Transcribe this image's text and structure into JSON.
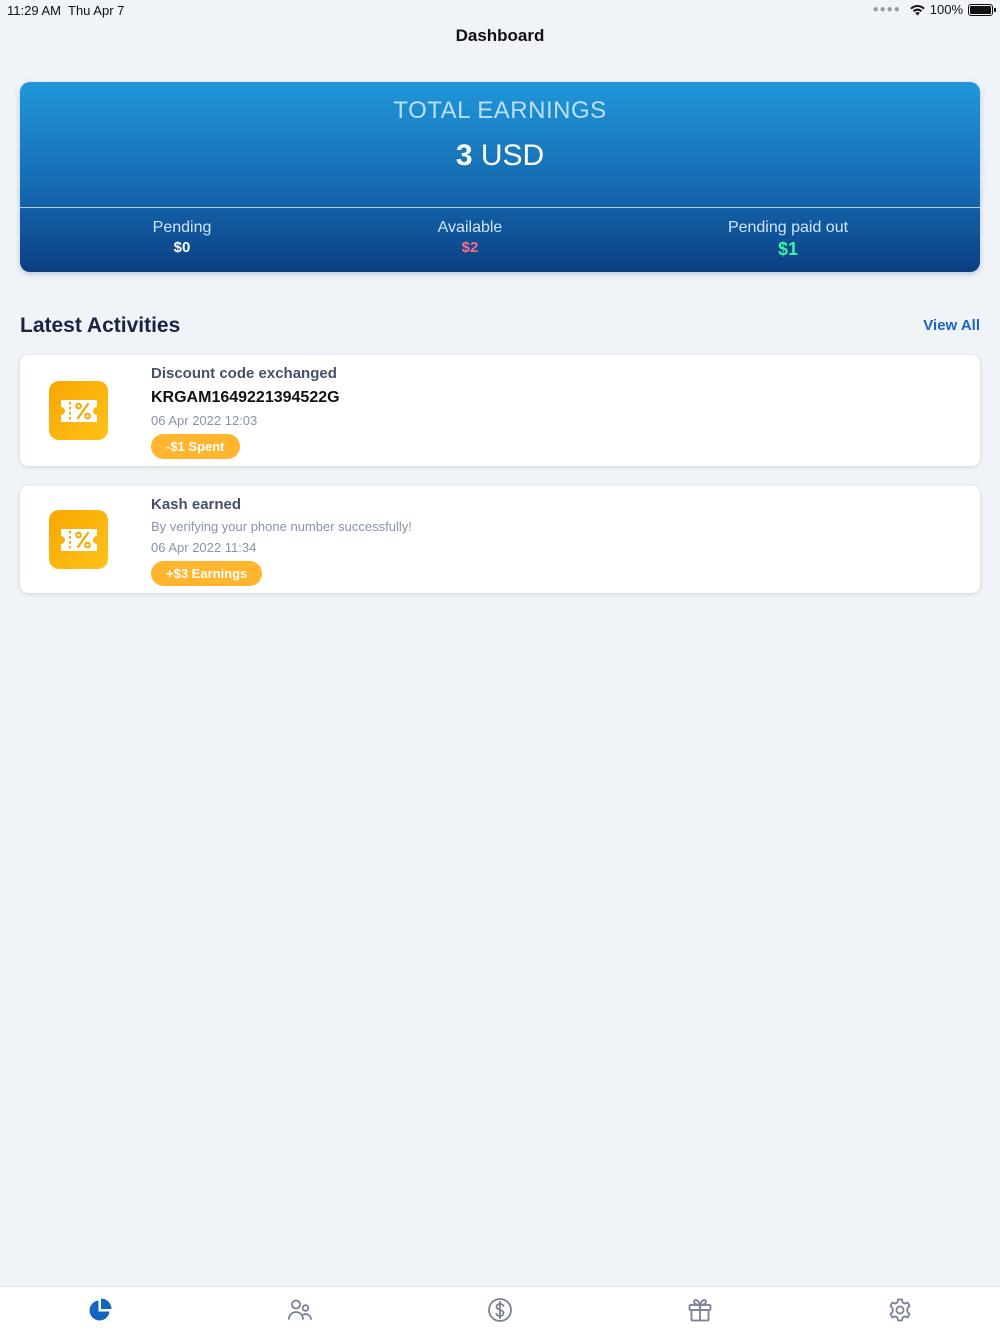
{
  "status_bar": {
    "time": "11:29 AM",
    "date": "Thu Apr 7",
    "battery": "100%"
  },
  "header": {
    "title": "Dashboard"
  },
  "earnings": {
    "label": "TOTAL EARNINGS",
    "amount": "3",
    "currency": "USD",
    "stats": [
      {
        "label": "Pending",
        "value": "$0"
      },
      {
        "label": "Available",
        "value": "$2"
      },
      {
        "label": "Pending paid out",
        "value": "$1"
      }
    ]
  },
  "activities": {
    "title": "Latest Activities",
    "view_all": "View All",
    "items": [
      {
        "title": "Discount code exchanged",
        "code": "KRGAM1649221394522G",
        "date": "06 Apr 2022 12:03",
        "badge": "-$1 Spent",
        "icon": "coupon-icon"
      },
      {
        "title": "Kash earned",
        "description": "By verifying your phone number successfully!",
        "date": "06 Apr 2022 11:34",
        "badge": "+$3 Earnings",
        "icon": "coupon-icon"
      }
    ]
  },
  "tabs": [
    {
      "icon": "pie-chart-icon",
      "active": true
    },
    {
      "icon": "users-icon",
      "active": false
    },
    {
      "icon": "dollar-circle-icon",
      "active": false
    },
    {
      "icon": "gift-icon",
      "active": false
    },
    {
      "icon": "gear-icon",
      "active": false
    }
  ],
  "colors": {
    "accent": "#1565c0",
    "card_top": "#2197da",
    "card_bottom": "#0b3f82",
    "badge": "#ffb52e",
    "available": "#ff6b8a",
    "paid_out": "#3df2a0",
    "tab_inactive": "#7a8194"
  }
}
